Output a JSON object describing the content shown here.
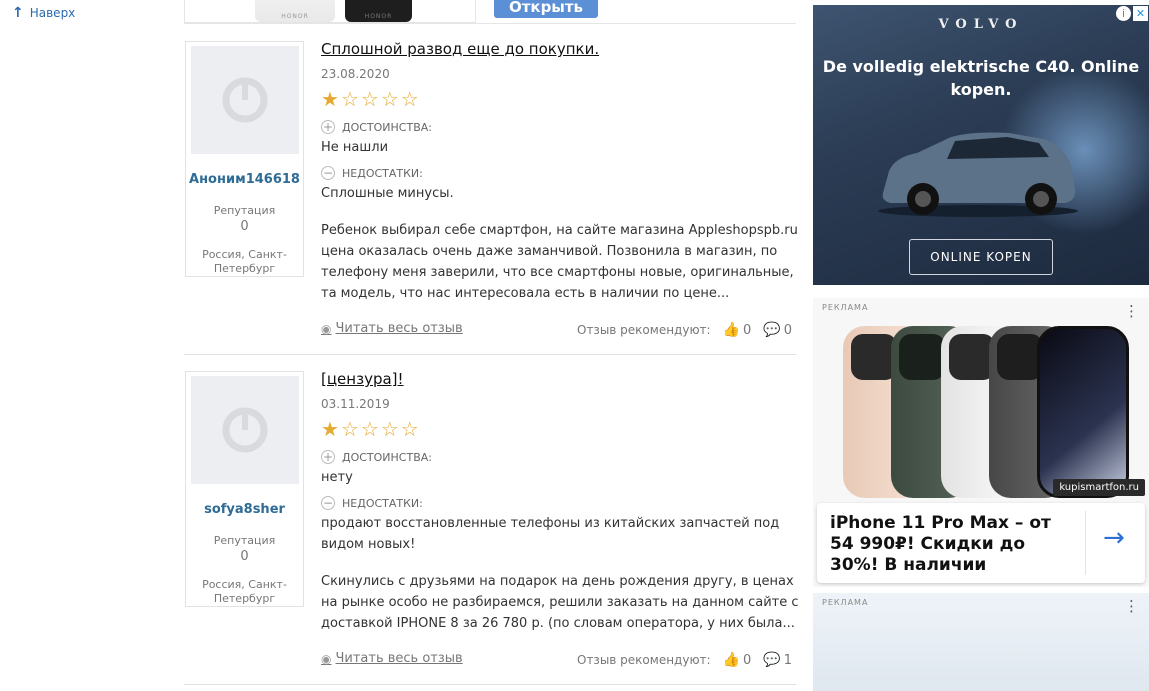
{
  "nav": {
    "back_to_top": "Наверх"
  },
  "top_strip": {
    "open_button": "Открыть",
    "phone_brand_1": "HONOR",
    "phone_brand_2": "HONOR"
  },
  "reviews": [
    {
      "username": "Аноним146618",
      "reputation_label": "Репутация",
      "reputation": "0",
      "location": "Россия, Санкт-Петербург",
      "title": "Сплошной развод еще до покупки.",
      "date": "23.08.2020",
      "rating": 1,
      "rating_max": 5,
      "pros_label": "ДОСТОИНСТВА:",
      "pros": "Не нашли",
      "cons_label": "НЕДОСТАТКИ:",
      "cons": "Сплошные минусы.",
      "text": "Ребенок выбирал себе смартфон, на сайте магазина Appleshopspb.ru цена оказалась очень даже заманчивой. Позвонила в магазин, по телефону меня заверили, что все смартфоны новые, оригинальные, та модель, что нас интересовала есть в наличии по цене...",
      "read_more": "Читать весь отзыв",
      "recommend_label": "Отзыв рекомендуют:",
      "likes": "0",
      "comments": "0"
    },
    {
      "username": "sofya8sher",
      "reputation_label": "Репутация",
      "reputation": "0",
      "location": "Россия, Санкт-Петербург",
      "title": "[цензура]!",
      "date": "03.11.2019",
      "rating": 1,
      "rating_max": 5,
      "pros_label": "ДОСТОИНСТВА:",
      "pros": "нету",
      "cons_label": "НЕДОСТАТКИ:",
      "cons": "продают восстановленные телефоны из китайских запчастей под видом новых!",
      "text": "Скинулись с друзьями на подарок на день рождения другу, в ценах на рынке особо не разбираемся, решили заказать на данном сайте с доставкой IPHONE 8 за 26 780 р. (по словам оператора, у них была...",
      "read_more": "Читать весь отзыв",
      "recommend_label": "Отзыв рекомендуют:",
      "likes": "0",
      "comments": "1"
    }
  ],
  "ads": {
    "volvo": {
      "brand": "VOLVO",
      "headline": "De volledig elektrische C40. Online kopen.",
      "cta": "ONLINE KOPEN",
      "colors": {
        "bg": "#2b3c54"
      }
    },
    "iphone": {
      "tag": "РЕКЛАМА",
      "shop": "kupismartfon.ru",
      "text": "iPhone 11 Pro Max – от 54 990₽! Скидки до 30%! В наличии",
      "accent": "#2b6fd6"
    },
    "third": {
      "tag": "РЕКЛАМА"
    }
  },
  "icons": {
    "back": "arrow-up-icon",
    "plus": "plus-circle-icon",
    "minus": "minus-circle-icon",
    "eye": "eye-icon",
    "thumb": "thumb-up-icon",
    "comment": "comment-icon",
    "star": "star-icon",
    "menu": "dots-vertical-icon",
    "arrow": "arrow-right-icon"
  }
}
